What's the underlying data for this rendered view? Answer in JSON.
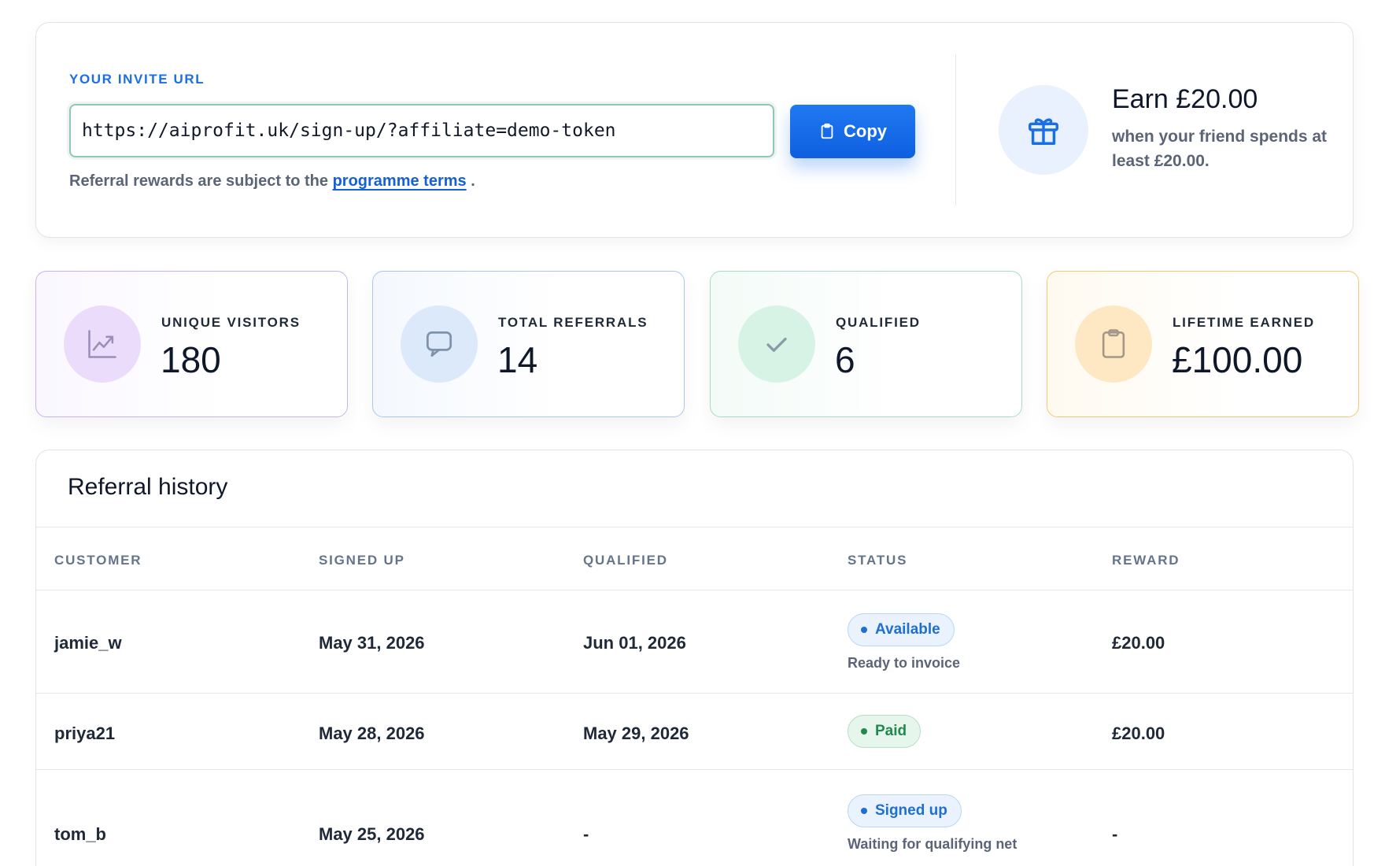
{
  "invite": {
    "label": "YOUR INVITE URL",
    "url": "https://aiprofit.uk/sign-up/?affiliate=demo-token",
    "copy_label": "Copy",
    "terms_prefix": "Referral rewards are subject to the",
    "terms_link": "programme terms",
    "terms_suffix": "."
  },
  "reward": {
    "title": "Earn £20.00",
    "subtitle": "when your friend spends at least £20.00."
  },
  "stats": {
    "visitors": {
      "label": "UNIQUE VISITORS",
      "value": "180",
      "icon": "trend-chart-icon"
    },
    "referrals": {
      "label": "TOTAL REFERRALS",
      "value": "14",
      "icon": "chat-bubble-icon"
    },
    "qualified": {
      "label": "QUALIFIED",
      "value": "6",
      "icon": "check-icon"
    },
    "earned": {
      "label": "LIFETIME EARNED",
      "value": "£100.00",
      "icon": "clipboard-icon"
    }
  },
  "history": {
    "title": "Referral history",
    "columns": [
      "CUSTOMER",
      "SIGNED UP",
      "QUALIFIED",
      "STATUS",
      "REWARD"
    ],
    "rows": [
      {
        "customer": "jamie_w",
        "signed_up": "May 31, 2026",
        "qualified": "Jun 01, 2026",
        "status": "Available",
        "note": "Ready to invoice",
        "reward": "£20.00"
      },
      {
        "customer": "priya21",
        "signed_up": "May 28, 2026",
        "qualified": "May 29, 2026",
        "status": "Paid",
        "note": "",
        "reward": "£20.00"
      },
      {
        "customer": "tom_b",
        "signed_up": "May 25, 2026",
        "qualified": "-",
        "status": "Signed up",
        "note": "Waiting for qualifying net",
        "reward": "-"
      }
    ]
  },
  "colors": {
    "accent": "#1a6fe6",
    "copy_button": "#1467e8",
    "paid_green": "#1f8a4c"
  }
}
